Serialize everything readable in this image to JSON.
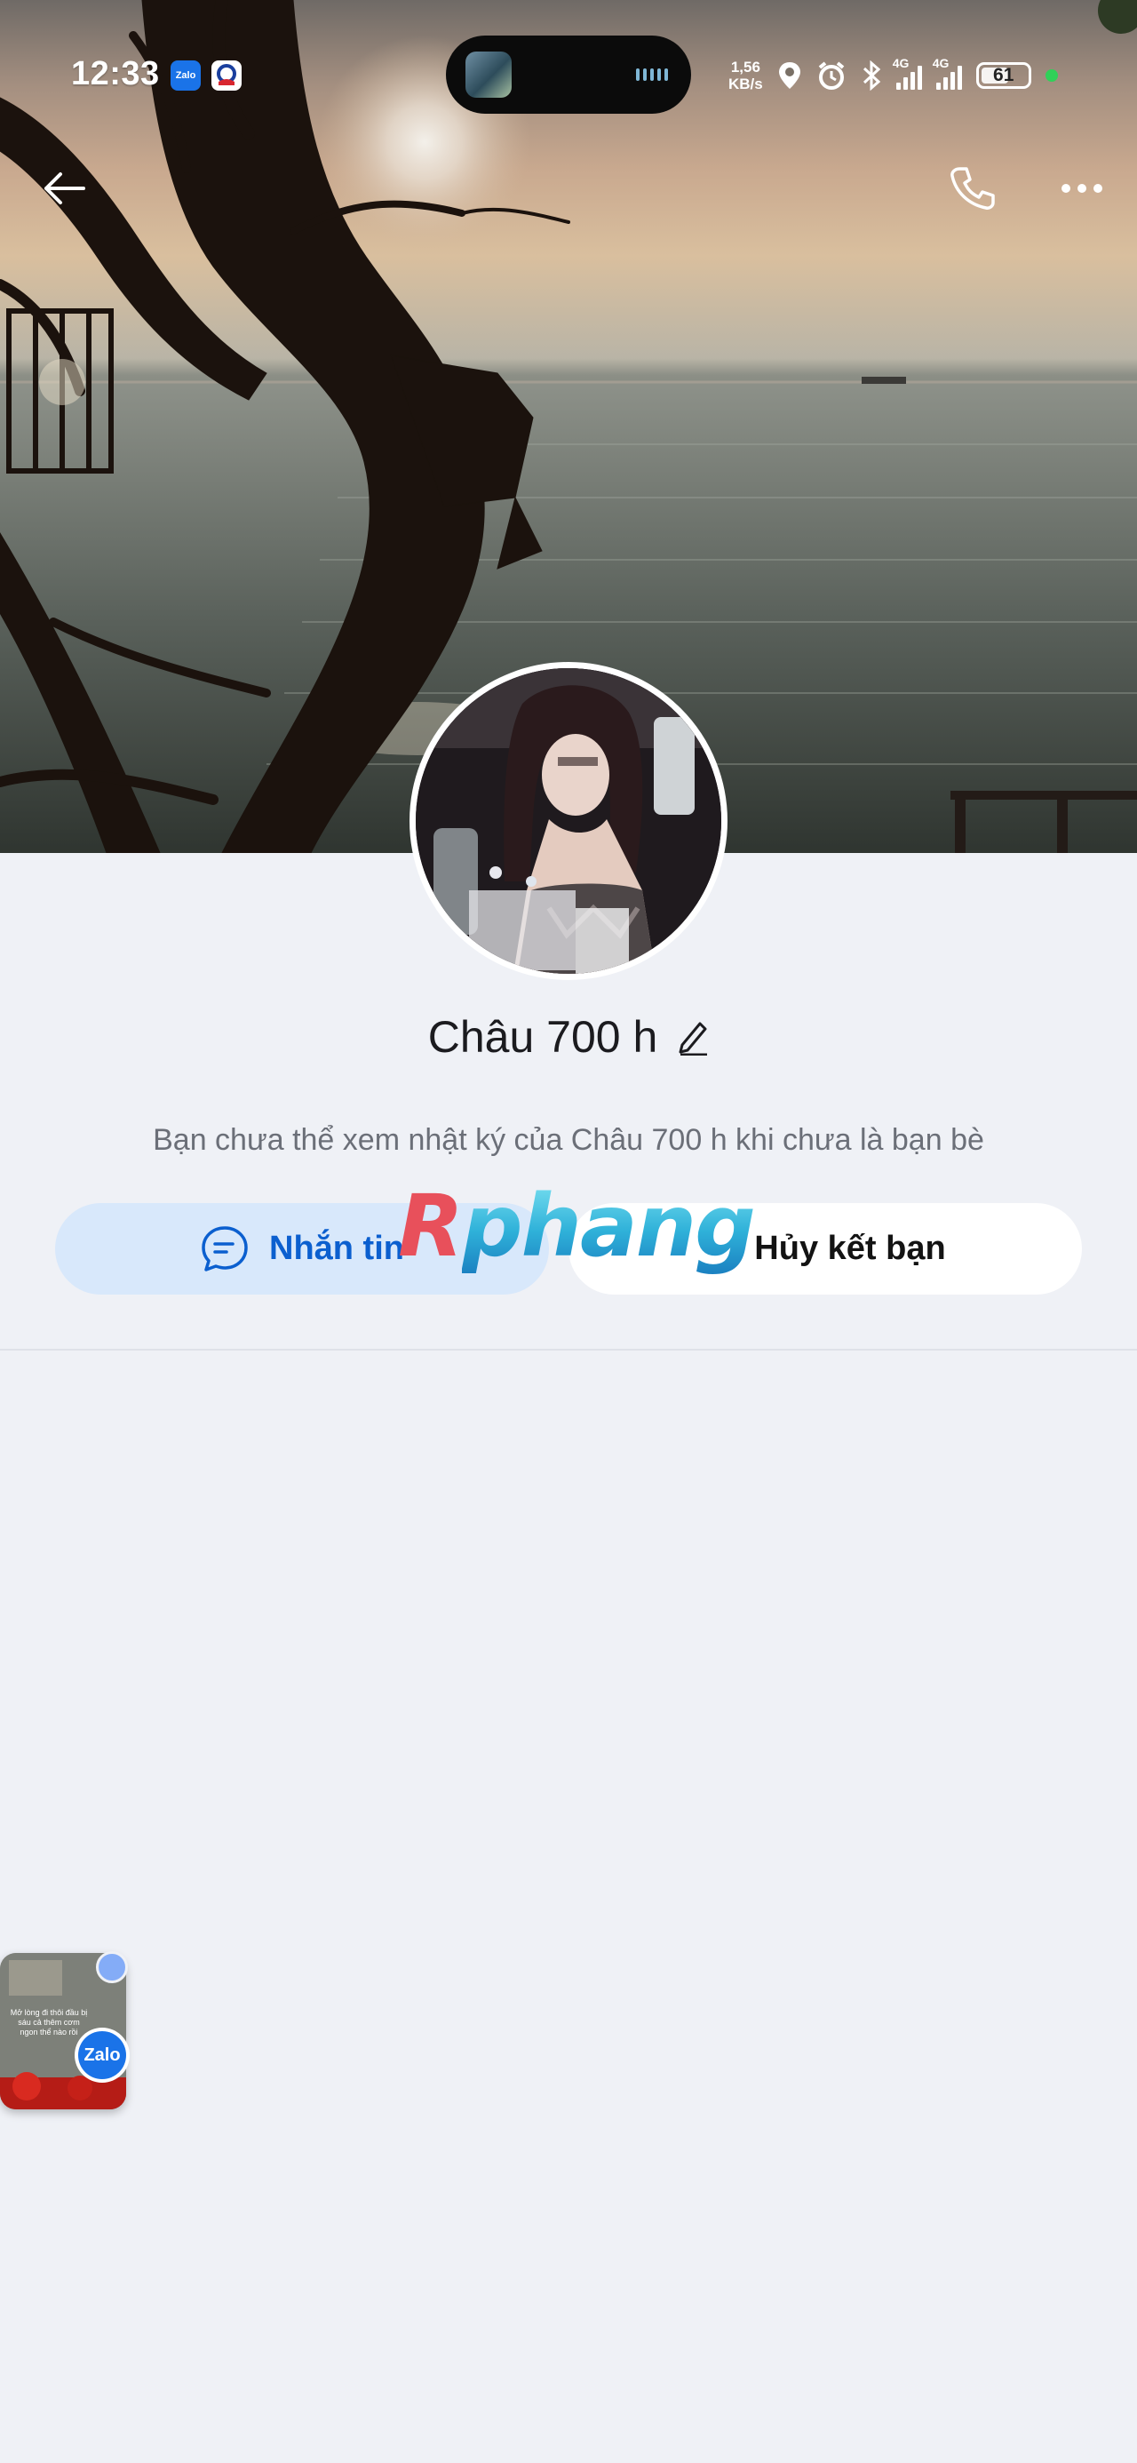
{
  "status_bar": {
    "time": "12:33",
    "notifications": [
      "zalo-app-icon",
      "news-app-icon"
    ],
    "network_speed": "1,56\nKB/s",
    "network_1": "4G",
    "network_2": "4G",
    "battery": "61",
    "battery_level_percent": 61
  },
  "header": {
    "back_icon": "arrow-left-icon",
    "call_icon": "phone-icon",
    "more_icon": "more-horizontal-icon"
  },
  "profile": {
    "name": "Châu 700 h",
    "edit_icon": "pencil-icon",
    "notice": "Bạn chưa thể xem nhật ký của Châu 700 h khi chưa là bạn bè"
  },
  "actions": {
    "message_label": "Nhắn tin",
    "unfriend_label": "Hủy kết bạn"
  },
  "watermark": {
    "first": "R",
    "rest": "phang"
  },
  "floating_bubble": {
    "caption": "Mở lòng đi thôi đầu bị sáu cả thêm cơm ngon thể nào rồi",
    "badge": "Zalo"
  },
  "colors": {
    "background": "#eff1f6",
    "message_button_bg": "#d8e8fb",
    "message_button_text": "#0b5fcf",
    "unfriend_button_bg": "#ffffff",
    "watermark_red": "#e8505b",
    "watermark_blue": "#2fb1d9"
  }
}
